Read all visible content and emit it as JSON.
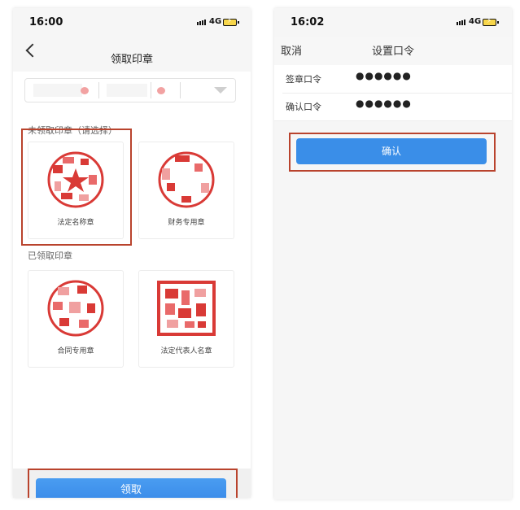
{
  "phone1": {
    "status": {
      "time": "16:00",
      "network": "4G"
    },
    "nav": {
      "title": "领取印章"
    },
    "unclaimed_title": "未领取印章（请选择）",
    "claimed_title": "已领取印章",
    "seals": [
      {
        "name": "法定名称章"
      },
      {
        "name": "财务专用章"
      },
      {
        "name": "合同专用章"
      },
      {
        "name": "法定代表人名章"
      }
    ],
    "claim_button": "领取"
  },
  "phone2": {
    "status": {
      "time": "16:02",
      "network": "4G"
    },
    "cancel": "取消",
    "title": "设置口令",
    "rows": [
      {
        "label": "签章口令",
        "value": "●●●●●●"
      },
      {
        "label": "确认口令",
        "value": "●●●●●●"
      }
    ],
    "confirm_button": "确认"
  },
  "colors": {
    "accent": "#3a8ee8",
    "highlight": "#b9432d",
    "seal": "#d93a36"
  }
}
